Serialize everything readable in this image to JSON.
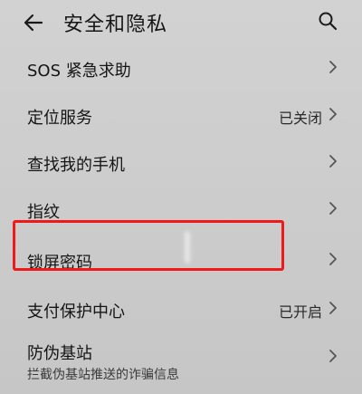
{
  "header": {
    "title": "安全和隐私",
    "back_icon": "back-arrow-icon",
    "search_icon": "search-icon"
  },
  "items": [
    {
      "label": "SOS 紧急求助",
      "value": ""
    },
    {
      "label": "定位服务",
      "value": "已关闭"
    },
    {
      "label": "查找我的手机",
      "value": ""
    },
    {
      "label": "指纹",
      "value": ""
    },
    {
      "label": "锁屏密码",
      "value": ""
    },
    {
      "label": "支付保护中心",
      "value": "已开启"
    },
    {
      "label": "防伪基站",
      "value": "",
      "subtitle": "拦截伪基站推送的诈骗信息"
    }
  ],
  "colors": {
    "highlight": "#f0191a",
    "background": "#cdcdcd"
  }
}
